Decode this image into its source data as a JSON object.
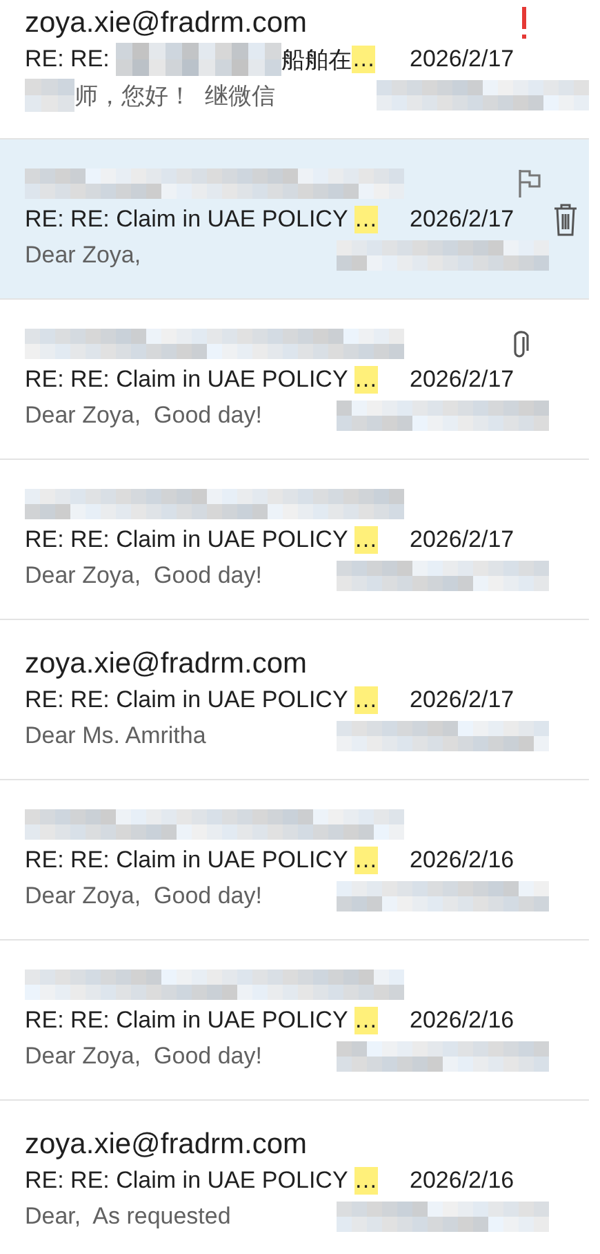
{
  "messages": [
    {
      "sender": "zoya.xie@fradrm.com",
      "important": true,
      "subject": "RE: RE: ",
      "subject_tail": "船舶在",
      "ellipsis": "…",
      "date": "2026/2/17",
      "preview": "师，您好！  继微信",
      "preview_masked": true,
      "selected": false,
      "actions": false,
      "attachment": false
    },
    {
      "subject": "RE: RE: Claim in UAE POLICY ",
      "ellipsis": "…",
      "date": "2026/2/17",
      "preview": "Dear Zoya,",
      "preview_masked": false,
      "selected": true,
      "actions": true,
      "attachment": false,
      "important": false
    },
    {
      "subject": "RE: RE: Claim in UAE POLICY ",
      "ellipsis": "…",
      "date": "2026/2/17",
      "preview": "Dear Zoya,  Good day!",
      "preview_masked": false,
      "selected": false,
      "actions": false,
      "attachment": true,
      "important": false
    },
    {
      "subject": "RE: RE: Claim in UAE POLICY ",
      "ellipsis": "…",
      "date": "2026/2/17",
      "preview": "Dear Zoya,  Good day!",
      "preview_masked": false,
      "selected": false,
      "actions": false,
      "attachment": false,
      "important": false
    },
    {
      "sender": "zoya.xie@fradrm.com",
      "subject": "RE: RE: Claim in UAE POLICY ",
      "ellipsis": "…",
      "date": "2026/2/17",
      "preview": "Dear Ms. Amritha",
      "preview_masked": false,
      "selected": false,
      "actions": false,
      "attachment": false,
      "important": false
    },
    {
      "subject": "RE: RE: Claim in UAE POLICY ",
      "ellipsis": "…",
      "date": "2026/2/16",
      "preview": "Dear Zoya,  Good day!",
      "preview_masked": false,
      "selected": false,
      "actions": false,
      "attachment": false,
      "important": false
    },
    {
      "subject": "RE: RE: Claim in UAE POLICY ",
      "ellipsis": "…",
      "date": "2026/2/16",
      "preview": "Dear Zoya,  Good day!",
      "preview_masked": false,
      "selected": false,
      "actions": false,
      "attachment": false,
      "important": false
    },
    {
      "sender": "zoya.xie@fradrm.com",
      "subject": "RE: RE: Claim in UAE POLICY ",
      "ellipsis": "…",
      "date": "2026/2/16",
      "preview": "Dear,  As requested",
      "preview_masked": false,
      "selected": false,
      "actions": false,
      "attachment": false,
      "important": false
    }
  ]
}
